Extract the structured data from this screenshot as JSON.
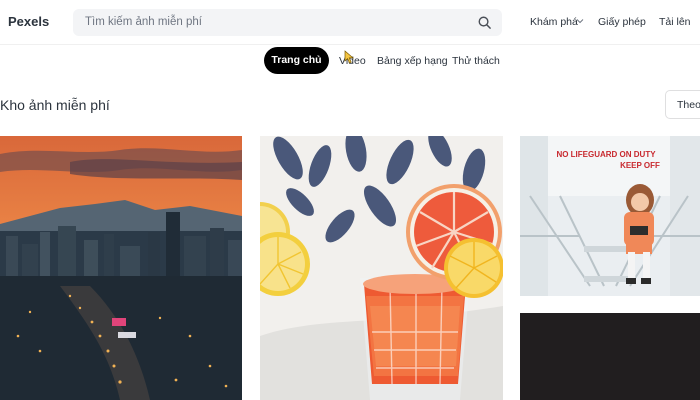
{
  "header": {
    "logo": "Pexels",
    "search_placeholder": "Tìm kiếm ảnh miễn phí",
    "nav": {
      "explore": "Khám phá",
      "license": "Giấy phép",
      "upload": "Tải lên"
    }
  },
  "tabs": [
    {
      "label": "Trang chủ",
      "active": true
    },
    {
      "label": "Video",
      "active": false
    },
    {
      "label": "Bảng xếp hạng",
      "active": false
    },
    {
      "label": "Thử thách",
      "active": false
    }
  ],
  "section": {
    "title": "Kho ảnh miễn phí",
    "sort_label": "Theo"
  },
  "photos": [
    {
      "name": "city-sunset-photo"
    },
    {
      "name": "grapefruit-drink-photo"
    },
    {
      "name": "lifeguard-girl-photo",
      "sign_line1": "NO LIFEGUARD ON DUTY",
      "sign_line2": "KEEP OFF"
    },
    {
      "name": "dark-photo"
    }
  ],
  "colors": {
    "accent_black": "#000000",
    "text": "#2c343e",
    "search_bg": "#f3f4f6"
  }
}
